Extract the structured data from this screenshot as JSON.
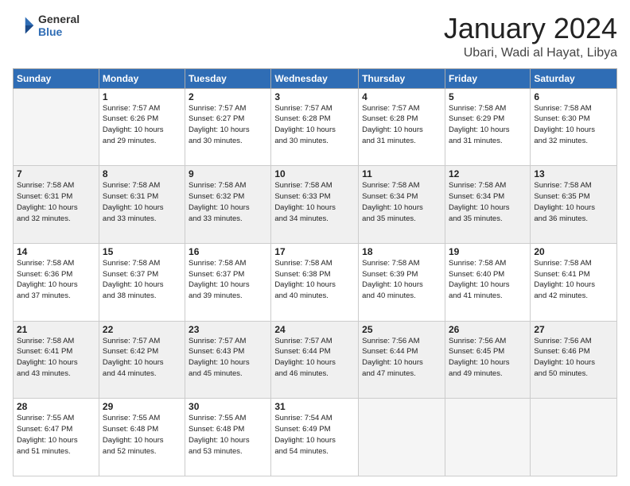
{
  "logo": {
    "line1": "General",
    "line2": "Blue"
  },
  "header": {
    "month": "January 2024",
    "location": "Ubari, Wadi al Hayat, Libya"
  },
  "weekdays": [
    "Sunday",
    "Monday",
    "Tuesday",
    "Wednesday",
    "Thursday",
    "Friday",
    "Saturday"
  ],
  "weeks": [
    [
      {
        "day": "",
        "info": ""
      },
      {
        "day": "1",
        "info": "Sunrise: 7:57 AM\nSunset: 6:26 PM\nDaylight: 10 hours\nand 29 minutes."
      },
      {
        "day": "2",
        "info": "Sunrise: 7:57 AM\nSunset: 6:27 PM\nDaylight: 10 hours\nand 30 minutes."
      },
      {
        "day": "3",
        "info": "Sunrise: 7:57 AM\nSunset: 6:28 PM\nDaylight: 10 hours\nand 30 minutes."
      },
      {
        "day": "4",
        "info": "Sunrise: 7:57 AM\nSunset: 6:28 PM\nDaylight: 10 hours\nand 31 minutes."
      },
      {
        "day": "5",
        "info": "Sunrise: 7:58 AM\nSunset: 6:29 PM\nDaylight: 10 hours\nand 31 minutes."
      },
      {
        "day": "6",
        "info": "Sunrise: 7:58 AM\nSunset: 6:30 PM\nDaylight: 10 hours\nand 32 minutes."
      }
    ],
    [
      {
        "day": "7",
        "info": "Sunrise: 7:58 AM\nSunset: 6:31 PM\nDaylight: 10 hours\nand 32 minutes."
      },
      {
        "day": "8",
        "info": "Sunrise: 7:58 AM\nSunset: 6:31 PM\nDaylight: 10 hours\nand 33 minutes."
      },
      {
        "day": "9",
        "info": "Sunrise: 7:58 AM\nSunset: 6:32 PM\nDaylight: 10 hours\nand 33 minutes."
      },
      {
        "day": "10",
        "info": "Sunrise: 7:58 AM\nSunset: 6:33 PM\nDaylight: 10 hours\nand 34 minutes."
      },
      {
        "day": "11",
        "info": "Sunrise: 7:58 AM\nSunset: 6:34 PM\nDaylight: 10 hours\nand 35 minutes."
      },
      {
        "day": "12",
        "info": "Sunrise: 7:58 AM\nSunset: 6:34 PM\nDaylight: 10 hours\nand 35 minutes."
      },
      {
        "day": "13",
        "info": "Sunrise: 7:58 AM\nSunset: 6:35 PM\nDaylight: 10 hours\nand 36 minutes."
      }
    ],
    [
      {
        "day": "14",
        "info": "Sunrise: 7:58 AM\nSunset: 6:36 PM\nDaylight: 10 hours\nand 37 minutes."
      },
      {
        "day": "15",
        "info": "Sunrise: 7:58 AM\nSunset: 6:37 PM\nDaylight: 10 hours\nand 38 minutes."
      },
      {
        "day": "16",
        "info": "Sunrise: 7:58 AM\nSunset: 6:37 PM\nDaylight: 10 hours\nand 39 minutes."
      },
      {
        "day": "17",
        "info": "Sunrise: 7:58 AM\nSunset: 6:38 PM\nDaylight: 10 hours\nand 40 minutes."
      },
      {
        "day": "18",
        "info": "Sunrise: 7:58 AM\nSunset: 6:39 PM\nDaylight: 10 hours\nand 40 minutes."
      },
      {
        "day": "19",
        "info": "Sunrise: 7:58 AM\nSunset: 6:40 PM\nDaylight: 10 hours\nand 41 minutes."
      },
      {
        "day": "20",
        "info": "Sunrise: 7:58 AM\nSunset: 6:41 PM\nDaylight: 10 hours\nand 42 minutes."
      }
    ],
    [
      {
        "day": "21",
        "info": "Sunrise: 7:58 AM\nSunset: 6:41 PM\nDaylight: 10 hours\nand 43 minutes."
      },
      {
        "day": "22",
        "info": "Sunrise: 7:57 AM\nSunset: 6:42 PM\nDaylight: 10 hours\nand 44 minutes."
      },
      {
        "day": "23",
        "info": "Sunrise: 7:57 AM\nSunset: 6:43 PM\nDaylight: 10 hours\nand 45 minutes."
      },
      {
        "day": "24",
        "info": "Sunrise: 7:57 AM\nSunset: 6:44 PM\nDaylight: 10 hours\nand 46 minutes."
      },
      {
        "day": "25",
        "info": "Sunrise: 7:56 AM\nSunset: 6:44 PM\nDaylight: 10 hours\nand 47 minutes."
      },
      {
        "day": "26",
        "info": "Sunrise: 7:56 AM\nSunset: 6:45 PM\nDaylight: 10 hours\nand 49 minutes."
      },
      {
        "day": "27",
        "info": "Sunrise: 7:56 AM\nSunset: 6:46 PM\nDaylight: 10 hours\nand 50 minutes."
      }
    ],
    [
      {
        "day": "28",
        "info": "Sunrise: 7:55 AM\nSunset: 6:47 PM\nDaylight: 10 hours\nand 51 minutes."
      },
      {
        "day": "29",
        "info": "Sunrise: 7:55 AM\nSunset: 6:48 PM\nDaylight: 10 hours\nand 52 minutes."
      },
      {
        "day": "30",
        "info": "Sunrise: 7:55 AM\nSunset: 6:48 PM\nDaylight: 10 hours\nand 53 minutes."
      },
      {
        "day": "31",
        "info": "Sunrise: 7:54 AM\nSunset: 6:49 PM\nDaylight: 10 hours\nand 54 minutes."
      },
      {
        "day": "",
        "info": ""
      },
      {
        "day": "",
        "info": ""
      },
      {
        "day": "",
        "info": ""
      }
    ]
  ]
}
